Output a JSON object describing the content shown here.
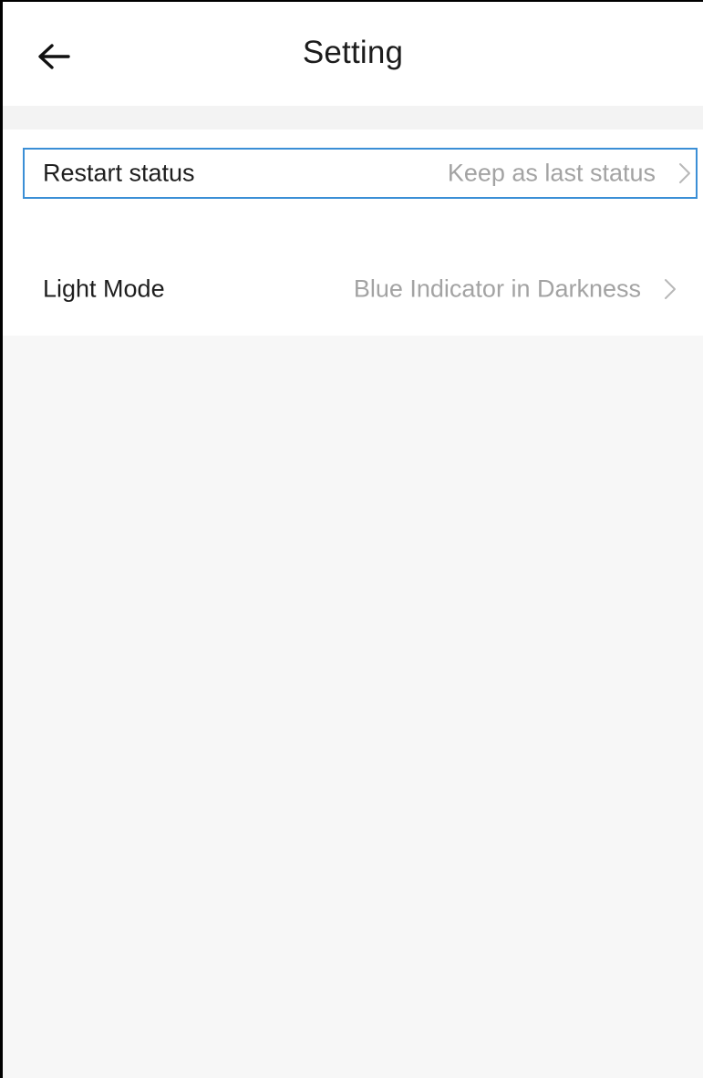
{
  "header": {
    "title": "Setting",
    "back_icon": "arrow-left-icon"
  },
  "settings": [
    {
      "label": "Restart status",
      "value": "Keep as last status",
      "icon": "chevron-right-icon"
    },
    {
      "label": "Light Mode",
      "value": "Blue Indicator in Darkness",
      "icon": "chevron-right-icon"
    }
  ],
  "colors": {
    "background": "#f7f7f7",
    "surface": "#ffffff",
    "text_primary": "#1e1e1e",
    "text_secondary": "#a3a3a3",
    "focus_outline": "#3b8fd6"
  }
}
